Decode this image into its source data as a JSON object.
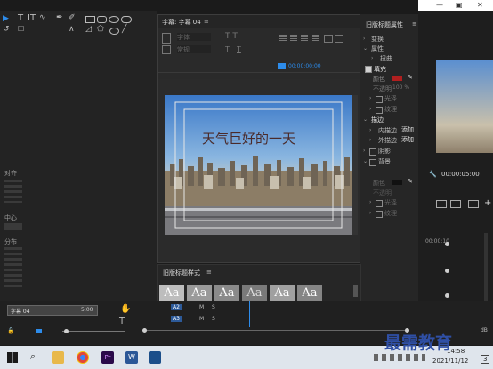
{
  "dialog": {
    "tab_label": "字幕: 字幕 04",
    "menu_glyph": "≡",
    "timecode": "00:00:00:00",
    "font_placeholder": "字体",
    "style_placeholder": "常规",
    "canvas_text": "天气巨好的一天"
  },
  "properties": {
    "title": "旧版标题属性",
    "items": {
      "transform": "变换",
      "properties": "属性",
      "distort": "扭曲",
      "fill": "填充",
      "color": "颜色",
      "opacity": "不透明",
      "opacity_value": "100 %",
      "sheen": "光泽",
      "texture": "纹理",
      "stroke": "描边",
      "inner_stroke": "内描边",
      "outer_stroke": "外描边",
      "add": "添加",
      "shadow": "阴影",
      "background": "背景",
      "bg_color": "颜色",
      "bg_opacity": "不透明",
      "bg_sheen": "光泽",
      "bg_texture": "纹理"
    }
  },
  "styles": {
    "title": "旧版标题样式",
    "menu_glyph": "≡",
    "swatch_label": "Aa"
  },
  "left_panel": {
    "align_label": "对齐",
    "center_label": "中心",
    "distribute_label": "分布"
  },
  "timeline": {
    "clip_name": "字幕 04",
    "clip_time": "5:00",
    "track_a2": "A2",
    "track_a3": "A3",
    "m_label": "M",
    "s_label": "S",
    "program_timecode": "00:00:05:00",
    "meter_top": "00:00:10",
    "db_label": "dB"
  },
  "taskbar": {
    "time": "14:58",
    "date": "2021/11/12",
    "watermark": "最需教育",
    "badge": "3"
  },
  "colors": {
    "accent_blue": "#2d8ceb",
    "fill_red": "#b01f1f",
    "text_dark": "#4a2b2b"
  }
}
